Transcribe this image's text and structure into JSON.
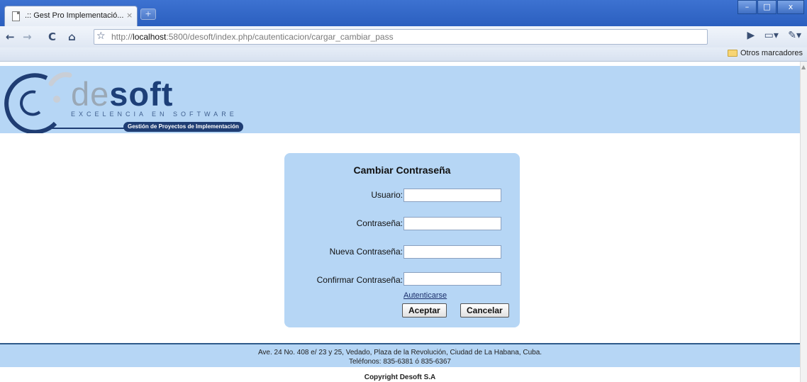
{
  "browser": {
    "tab_title": ".:: Gest Pro Implementació...",
    "tab_close": "×",
    "new_tab": "+",
    "window_buttons": {
      "minimize": "–",
      "maximize": "□",
      "close": "x"
    },
    "nav": {
      "back": "←",
      "forward": "→",
      "reload": "C",
      "home": "⌂"
    },
    "url_host": "localhost",
    "url_prefix": "http://",
    "url_rest": ":5800/desoft/index.php/cautenticacion/cargar_cambiar_pass",
    "bookmark_folder": "Otros marcadores"
  },
  "header": {
    "logo_de": "de",
    "logo_soft": "soft",
    "tagline": "EXCELENCIA EN SOFTWARE",
    "subtitle": "Gestión de Proyectos de Implementación"
  },
  "form": {
    "title": "Cambiar Contraseña",
    "fields": [
      {
        "label": "Usuario:",
        "value": ""
      },
      {
        "label": "Contraseña:",
        "value": ""
      },
      {
        "label": "Nueva Contraseña:",
        "value": ""
      },
      {
        "label": "Confirmar Contraseña:",
        "value": ""
      }
    ],
    "link": "Autenticarse",
    "accept": "Aceptar",
    "cancel": "Cancelar"
  },
  "footer": {
    "address": "Ave. 24 No. 408 e/ 23 y 25, Vedado, Plaza de la Revolución, Ciudad de La Habana, Cuba.",
    "phones": "Teléfonos: 835-6381 ó 835-6367",
    "copyright": "Copyright Desoft S.A"
  }
}
